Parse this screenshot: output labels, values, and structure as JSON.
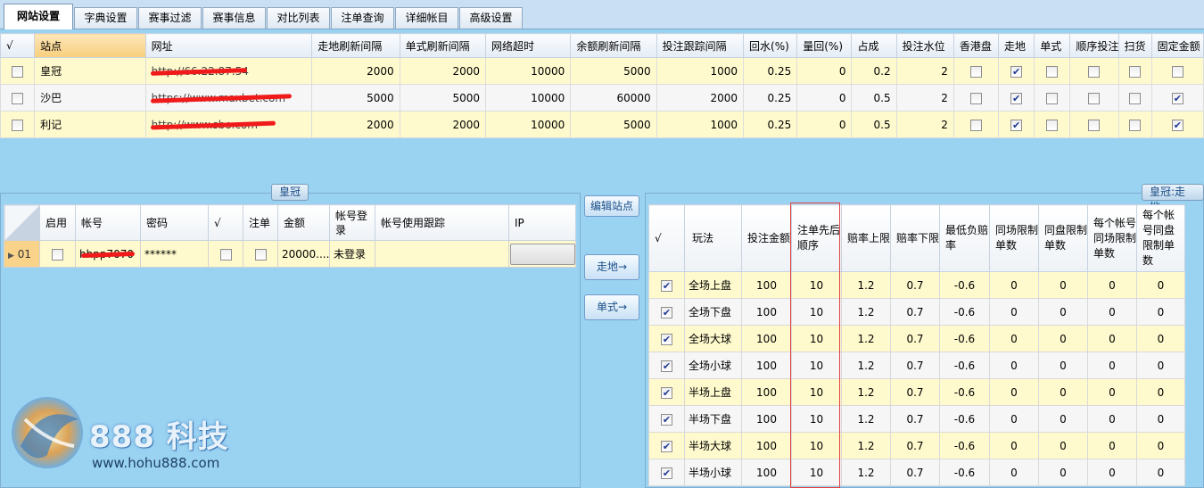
{
  "tabs": [
    "网站设置",
    "字典设置",
    "赛事过滤",
    "赛事信息",
    "对比列表",
    "注单查询",
    "详细帐目",
    "高级设置"
  ],
  "site_grid": {
    "headers": [
      "√",
      "站点",
      "网址",
      "走地刷新间隔",
      "单式刷新间隔",
      "网络超时",
      "余额刷新间隔",
      "投注跟踪间隔",
      "回水(%)",
      "量回(%)",
      "占成",
      "投注水位",
      "香港盘",
      "走地",
      "单式",
      "顺序投注",
      "扫货",
      "固定金额"
    ],
    "rows": [
      {
        "site": "皇冠",
        "url": "http://66.22.87.54",
        "live_refresh": "2000",
        "single_refresh": "2000",
        "timeout": "10000",
        "balance_refresh": "5000",
        "track": "1000",
        "rebate": "0.25",
        "back": "0",
        "share": "0.2",
        "level": "2",
        "hk": false,
        "live": true,
        "single": false,
        "order": false,
        "sweep": false,
        "fixed": false
      },
      {
        "site": "沙巴",
        "url": "https://www.maxbet.com",
        "live_refresh": "5000",
        "single_refresh": "5000",
        "timeout": "10000",
        "balance_refresh": "60000",
        "track": "2000",
        "rebate": "0.25",
        "back": "0",
        "share": "0.5",
        "level": "2",
        "hk": false,
        "live": true,
        "single": false,
        "order": false,
        "sweep": false,
        "fixed": true
      },
      {
        "site": "利记",
        "url": "http://www.sbo.com",
        "live_refresh": "2000",
        "single_refresh": "2000",
        "timeout": "10000",
        "balance_refresh": "5000",
        "track": "1000",
        "rebate": "0.25",
        "back": "0",
        "share": "0.5",
        "level": "2",
        "hk": false,
        "live": true,
        "single": false,
        "order": false,
        "sweep": false,
        "fixed": true
      }
    ]
  },
  "left_group": {
    "title": "皇冠",
    "headers": [
      "启用",
      "帐号",
      "密码",
      "√",
      "注单",
      "金额",
      "帐号登录",
      "帐号使用跟踪",
      "IP"
    ],
    "rows": [
      {
        "idx": "01",
        "account": "hhpp7070",
        "password": "******",
        "amount": "20000....",
        "login": "未登录"
      }
    ]
  },
  "buttons": {
    "edit_site": "编辑站点",
    "live": "走地→",
    "single": "单式→"
  },
  "right_group": {
    "title": "皇冠:走地",
    "headers": [
      "√",
      "玩法",
      "投注金额",
      "注单先后顺序",
      "赔率上限",
      "赔率下限",
      "最低负赔率",
      "同场限制单数",
      "同盘限制单数",
      "每个帐号同场限制单数",
      "每个帐号同盘限制单数"
    ],
    "rows": [
      {
        "play": "全场上盘",
        "amount": "100",
        "order": "10",
        "odds_max": "1.2",
        "odds_min": "0.7",
        "neg": "-0.6",
        "c1": "0",
        "c2": "0",
        "c3": "0",
        "c4": "0"
      },
      {
        "play": "全场下盘",
        "amount": "100",
        "order": "10",
        "odds_max": "1.2",
        "odds_min": "0.7",
        "neg": "-0.6",
        "c1": "0",
        "c2": "0",
        "c3": "0",
        "c4": "0"
      },
      {
        "play": "全场大球",
        "amount": "100",
        "order": "10",
        "odds_max": "1.2",
        "odds_min": "0.7",
        "neg": "-0.6",
        "c1": "0",
        "c2": "0",
        "c3": "0",
        "c4": "0"
      },
      {
        "play": "全场小球",
        "amount": "100",
        "order": "10",
        "odds_max": "1.2",
        "odds_min": "0.7",
        "neg": "-0.6",
        "c1": "0",
        "c2": "0",
        "c3": "0",
        "c4": "0"
      },
      {
        "play": "半场上盘",
        "amount": "100",
        "order": "10",
        "odds_max": "1.2",
        "odds_min": "0.7",
        "neg": "-0.6",
        "c1": "0",
        "c2": "0",
        "c3": "0",
        "c4": "0"
      },
      {
        "play": "半场下盘",
        "amount": "100",
        "order": "10",
        "odds_max": "1.2",
        "odds_min": "0.7",
        "neg": "-0.6",
        "c1": "0",
        "c2": "0",
        "c3": "0",
        "c4": "0"
      },
      {
        "play": "半场大球",
        "amount": "100",
        "order": "10",
        "odds_max": "1.2",
        "odds_min": "0.7",
        "neg": "-0.6",
        "c1": "0",
        "c2": "0",
        "c3": "0",
        "c4": "0"
      },
      {
        "play": "半场小球",
        "amount": "100",
        "order": "10",
        "odds_max": "1.2",
        "odds_min": "0.7",
        "neg": "-0.6",
        "c1": "0",
        "c2": "0",
        "c3": "0",
        "c4": "0"
      }
    ]
  },
  "logo": {
    "brand": "888 科技",
    "url": "www.hohu888.com"
  },
  "colors": {
    "background": "#9ad2f2",
    "row_highlight": "#fffacd",
    "selected_header": "#f8cf7d",
    "redaction": "#f01a1a"
  }
}
